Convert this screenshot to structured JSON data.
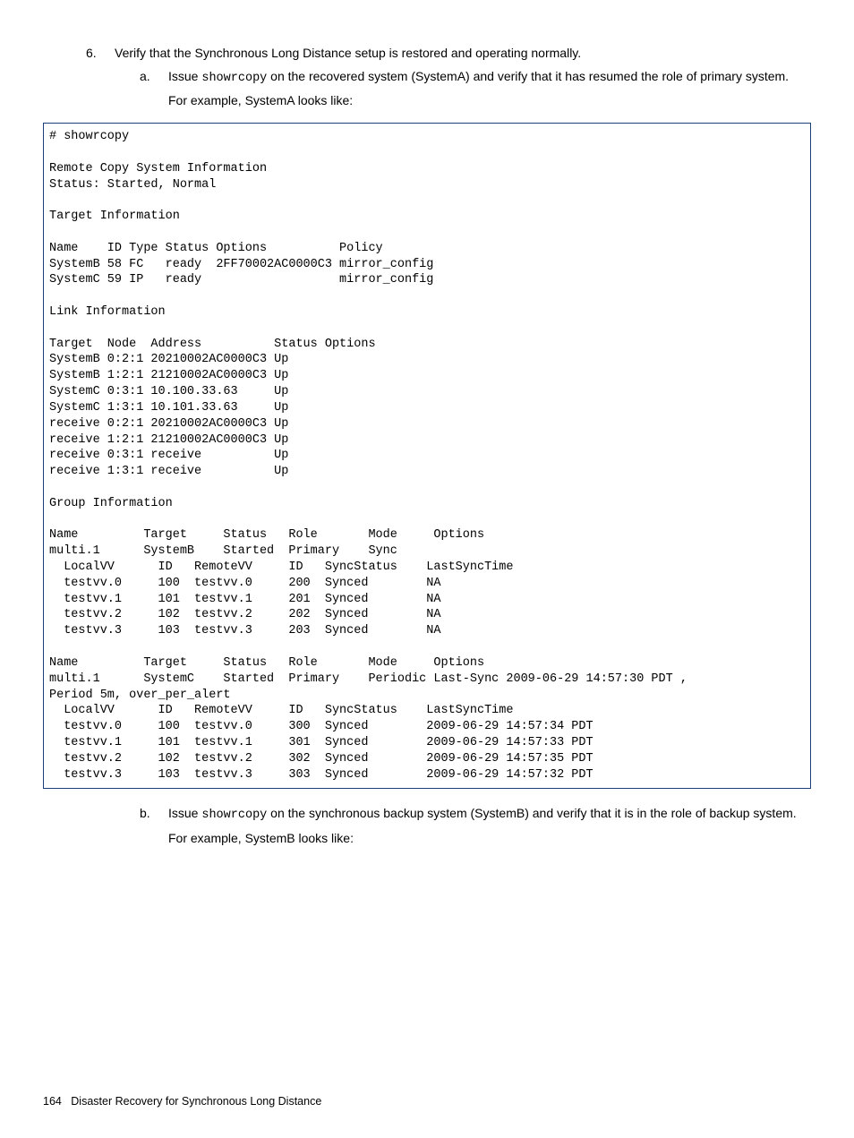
{
  "step6": {
    "num": "6.",
    "text": "Verify that the Synchronous Long Distance setup is restored and operating normally."
  },
  "subA": {
    "let": "a.",
    "text_pre": "Issue ",
    "cmd": "showrcopy",
    "text_post": " on the recovered system (SystemA) and verify that it has resumed the role of primary system.",
    "example": "For example, SystemA looks like:"
  },
  "terminal": "# showrcopy\n\nRemote Copy System Information\nStatus: Started, Normal\n\nTarget Information\n\nName    ID Type Status Options          Policy\nSystemB 58 FC   ready  2FF70002AC0000C3 mirror_config\nSystemC 59 IP   ready                   mirror_config\n\nLink Information\n\nTarget  Node  Address          Status Options\nSystemB 0:2:1 20210002AC0000C3 Up\nSystemB 1:2:1 21210002AC0000C3 Up\nSystemC 0:3:1 10.100.33.63     Up\nSystemC 1:3:1 10.101.33.63     Up\nreceive 0:2:1 20210002AC0000C3 Up\nreceive 1:2:1 21210002AC0000C3 Up\nreceive 0:3:1 receive          Up\nreceive 1:3:1 receive          Up\n\nGroup Information\n\nName         Target     Status   Role       Mode     Options\nmulti.1      SystemB    Started  Primary    Sync\n  LocalVV      ID   RemoteVV     ID   SyncStatus    LastSyncTime\n  testvv.0     100  testvv.0     200  Synced        NA\n  testvv.1     101  testvv.1     201  Synced        NA\n  testvv.2     102  testvv.2     202  Synced        NA\n  testvv.3     103  testvv.3     203  Synced        NA\n\nName         Target     Status   Role       Mode     Options\nmulti.1      SystemC    Started  Primary    Periodic Last-Sync 2009-06-29 14:57:30 PDT ,\nPeriod 5m, over_per_alert\n  LocalVV      ID   RemoteVV     ID   SyncStatus    LastSyncTime\n  testvv.0     100  testvv.0     300  Synced        2009-06-29 14:57:34 PDT\n  testvv.1     101  testvv.1     301  Synced        2009-06-29 14:57:33 PDT\n  testvv.2     102  testvv.2     302  Synced        2009-06-29 14:57:35 PDT\n  testvv.3     103  testvv.3     303  Synced        2009-06-29 14:57:32 PDT",
  "subB": {
    "let": "b.",
    "text_pre": "Issue ",
    "cmd": "showrcopy",
    "text_post": " on the synchronous backup system (SystemB) and verify that it is in the role of backup system.",
    "example": "For example, SystemB looks like:"
  },
  "footer": {
    "page": "164",
    "title": "Disaster Recovery for Synchronous Long Distance"
  }
}
